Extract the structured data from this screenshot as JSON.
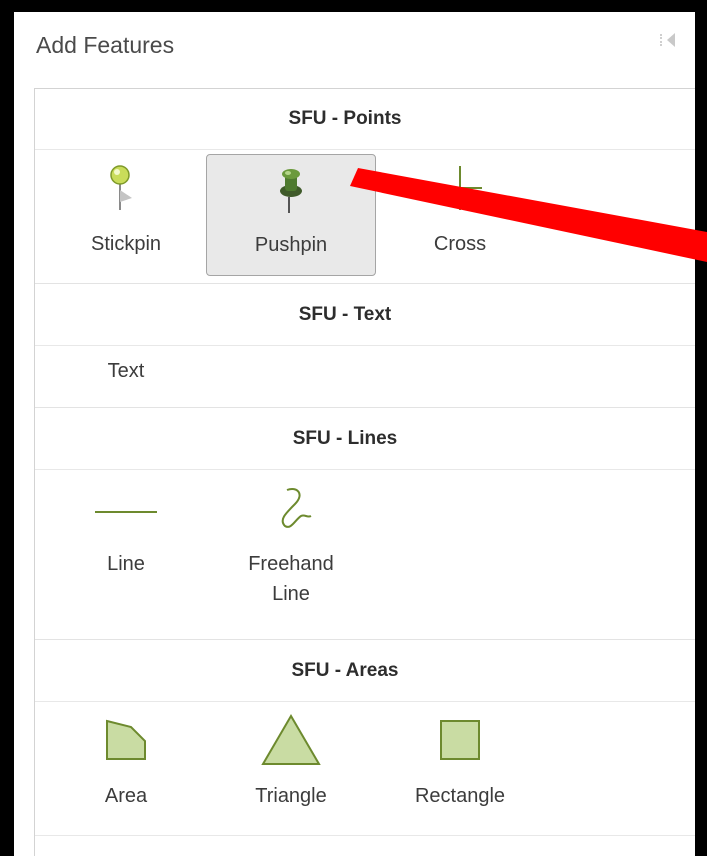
{
  "panel": {
    "title": "Add Features"
  },
  "sections": {
    "points": {
      "title": "SFU - Points",
      "items": [
        {
          "label": "Stickpin",
          "icon": "stickpin-icon"
        },
        {
          "label": "Pushpin",
          "icon": "pushpin-icon",
          "selected": true
        },
        {
          "label": "Cross",
          "icon": "cross-icon"
        }
      ]
    },
    "text": {
      "title": "SFU - Text",
      "items": [
        {
          "label": "Text"
        }
      ]
    },
    "lines": {
      "title": "SFU - Lines",
      "items": [
        {
          "label": "Line",
          "icon": "line-icon"
        },
        {
          "label": "Freehand\nLine",
          "icon": "freehand-line-icon"
        }
      ]
    },
    "areas": {
      "title": "SFU - Areas",
      "items": [
        {
          "label": "Area",
          "icon": "area-icon"
        },
        {
          "label": "Triangle",
          "icon": "triangle-icon"
        },
        {
          "label": "Rectangle",
          "icon": "rectangle-icon"
        }
      ]
    }
  },
  "colors": {
    "symbol_green": "#6d8a2e",
    "symbol_fill": "#c9dca3",
    "arrow": "#ff0000"
  }
}
